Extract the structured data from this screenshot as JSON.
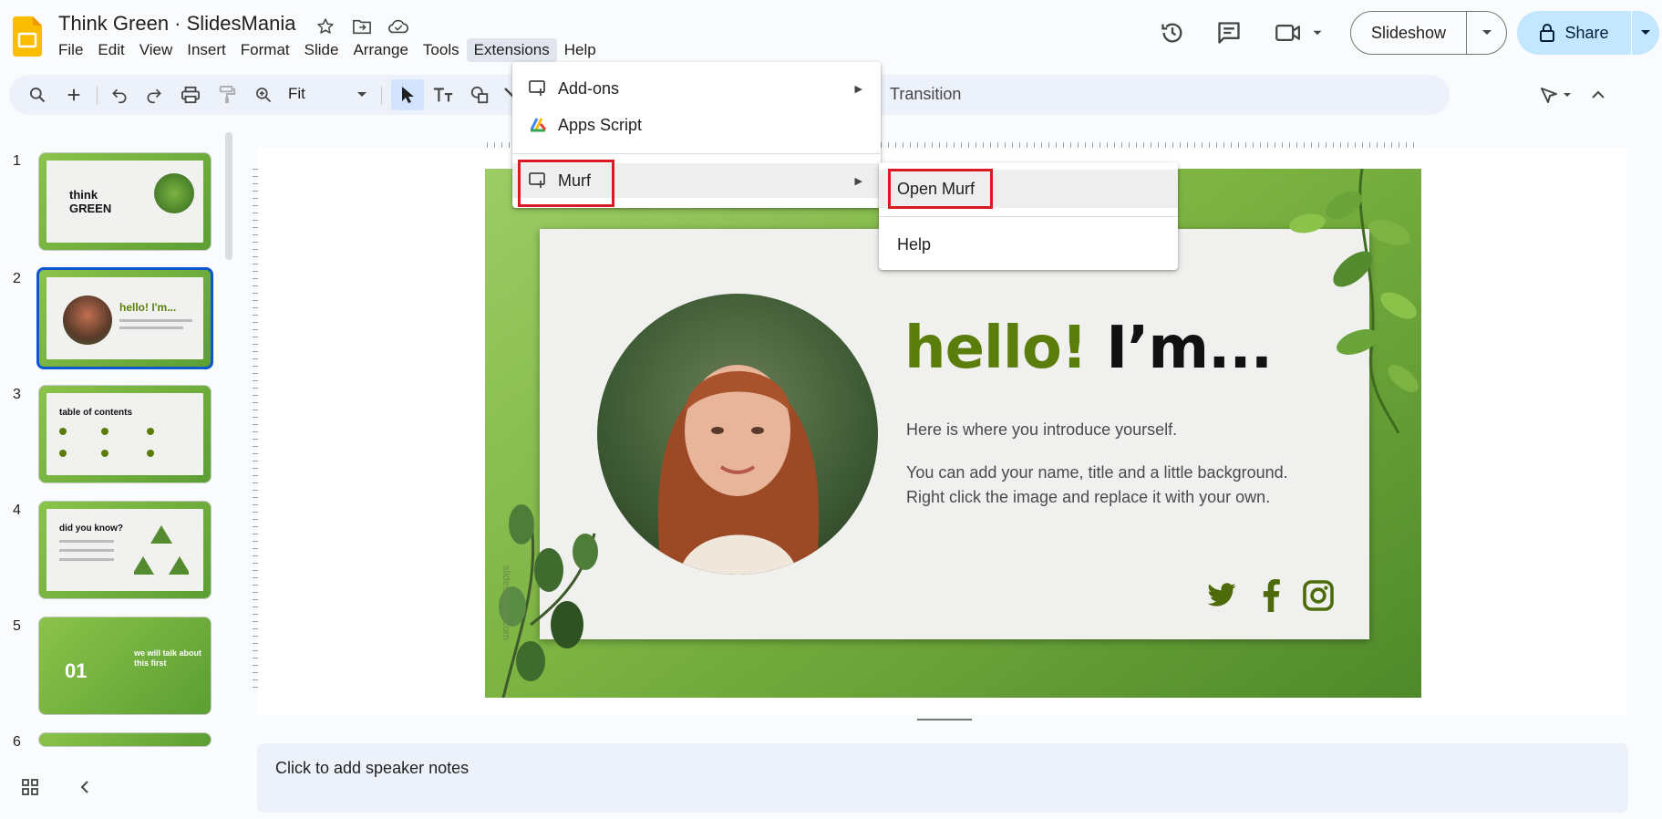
{
  "app": {
    "title": "Think Green · SlidesMania",
    "menus": [
      "File",
      "Edit",
      "View",
      "Insert",
      "Format",
      "Slide",
      "Arrange",
      "Tools",
      "Extensions",
      "Help"
    ],
    "active_menu": "Extensions"
  },
  "header": {
    "slideshow_label": "Slideshow",
    "share_label": "Share"
  },
  "toolbar": {
    "zoom_value": "Fit",
    "transition_label": "Transition"
  },
  "extensions_menu": {
    "items": [
      {
        "label": "Add-ons",
        "has_submenu": true
      },
      {
        "label": "Apps Script",
        "has_submenu": false
      },
      {
        "label": "Murf",
        "has_submenu": true
      }
    ]
  },
  "murf_submenu": {
    "items": [
      {
        "label": "Open Murf"
      },
      {
        "label": "Help"
      }
    ]
  },
  "filmstrip": {
    "slides": [
      {
        "number": "1",
        "text": "think GREEN"
      },
      {
        "number": "2",
        "text": "hello! I'm..."
      },
      {
        "number": "3",
        "text": "table of contents"
      },
      {
        "number": "4",
        "text": "did you know?"
      },
      {
        "number": "5",
        "text": "we will talk about this first",
        "big": "01"
      },
      {
        "number": "6",
        "text": ""
      }
    ],
    "selected": 2
  },
  "slide": {
    "hello_green": "hello!",
    "hello_dark": " I’m...",
    "intro1": "Here is where you introduce yourself.",
    "intro2": "You can add your name, title and a little background. Right click the image and replace it with your own.",
    "watermark": "slidesmania.com"
  },
  "notes": {
    "placeholder": "Click to add speaker notes"
  },
  "colors": {
    "accent_blue": "#0b57d0",
    "share_bg": "#c2e7ff",
    "highlight_red": "#d81b23",
    "slide_green": "#5a7d0c"
  }
}
